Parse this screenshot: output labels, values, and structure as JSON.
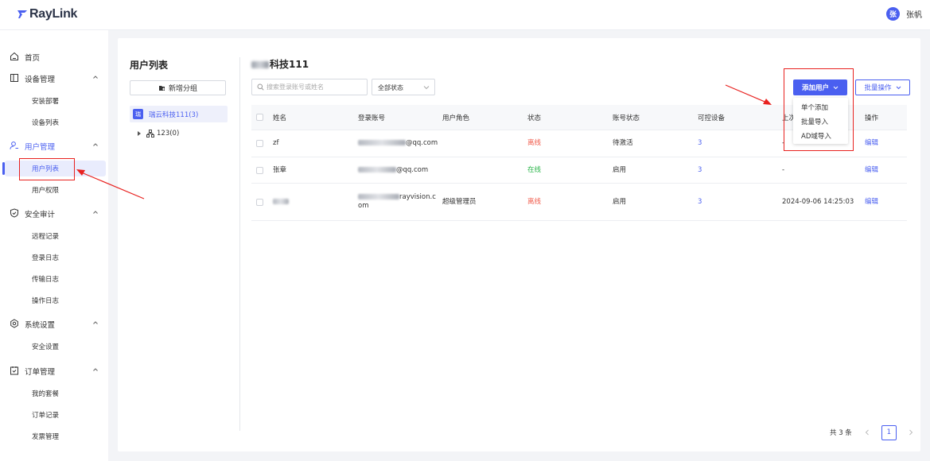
{
  "app": {
    "brand": "RayLink"
  },
  "user": {
    "avatar_char": "张",
    "name": "张帆"
  },
  "sidebar": {
    "groups": [
      {
        "label": "首页",
        "icon": "home-icon"
      },
      {
        "label": "设备管理",
        "icon": "device-icon",
        "items": [
          "安装部署",
          "设备列表"
        ]
      },
      {
        "label": "用户管理",
        "icon": "user-icon",
        "items": [
          "用户列表",
          "用户权限"
        ],
        "active_item": "用户列表"
      },
      {
        "label": "安全审计",
        "icon": "shield-icon",
        "items": [
          "远程记录",
          "登录日志",
          "传输日志",
          "操作日志"
        ]
      },
      {
        "label": "系统设置",
        "icon": "settings-icon",
        "items": [
          "安全设置"
        ]
      },
      {
        "label": "订单管理",
        "icon": "order-icon",
        "items": [
          "我的套餐",
          "订单记录",
          "发票管理"
        ]
      }
    ]
  },
  "tree": {
    "title": "用户列表",
    "add_group_label": "新增分组",
    "root": {
      "badge": "瑞",
      "label": "瑞云科技111(3)"
    },
    "child": {
      "label": "123(0)"
    }
  },
  "content": {
    "org_title_suffix": "科技111",
    "search_placeholder": "搜索登录账号或姓名",
    "status_filter": "全部状态",
    "add_user_label": "添加用户",
    "batch_label": "批量操作",
    "dropdown": [
      "单个添加",
      "批量导入",
      "AD域导入"
    ],
    "columns": [
      "姓名",
      "登录账号",
      "用户角色",
      "状态",
      "账号状态",
      "可控设备",
      "上次",
      "操作"
    ],
    "rows": [
      {
        "name": "zf",
        "account_suffix": "@qq.com",
        "role": "",
        "status": "离线",
        "account_status": "待激活",
        "devices": "3",
        "last": "-",
        "action": "编辑"
      },
      {
        "name": "张章",
        "account_suffix": "@qq.com",
        "role": "",
        "status": "在线",
        "account_status": "启用",
        "devices": "3",
        "last": "-",
        "action": "编辑"
      },
      {
        "name": "",
        "account_suffix": "rayvision.c",
        "account_line2": "om",
        "role": "超级管理员",
        "status": "离线",
        "account_status": "启用",
        "devices": "3",
        "last": "2024-09-06 14:25:03",
        "action": "编辑"
      }
    ]
  },
  "pagination": {
    "total": "共 3 条",
    "current": "1"
  },
  "colors": {
    "accent": "#4a5ff0",
    "offline": "#f05a4a",
    "online": "#2bb54a",
    "annotation": "#e8211f"
  }
}
